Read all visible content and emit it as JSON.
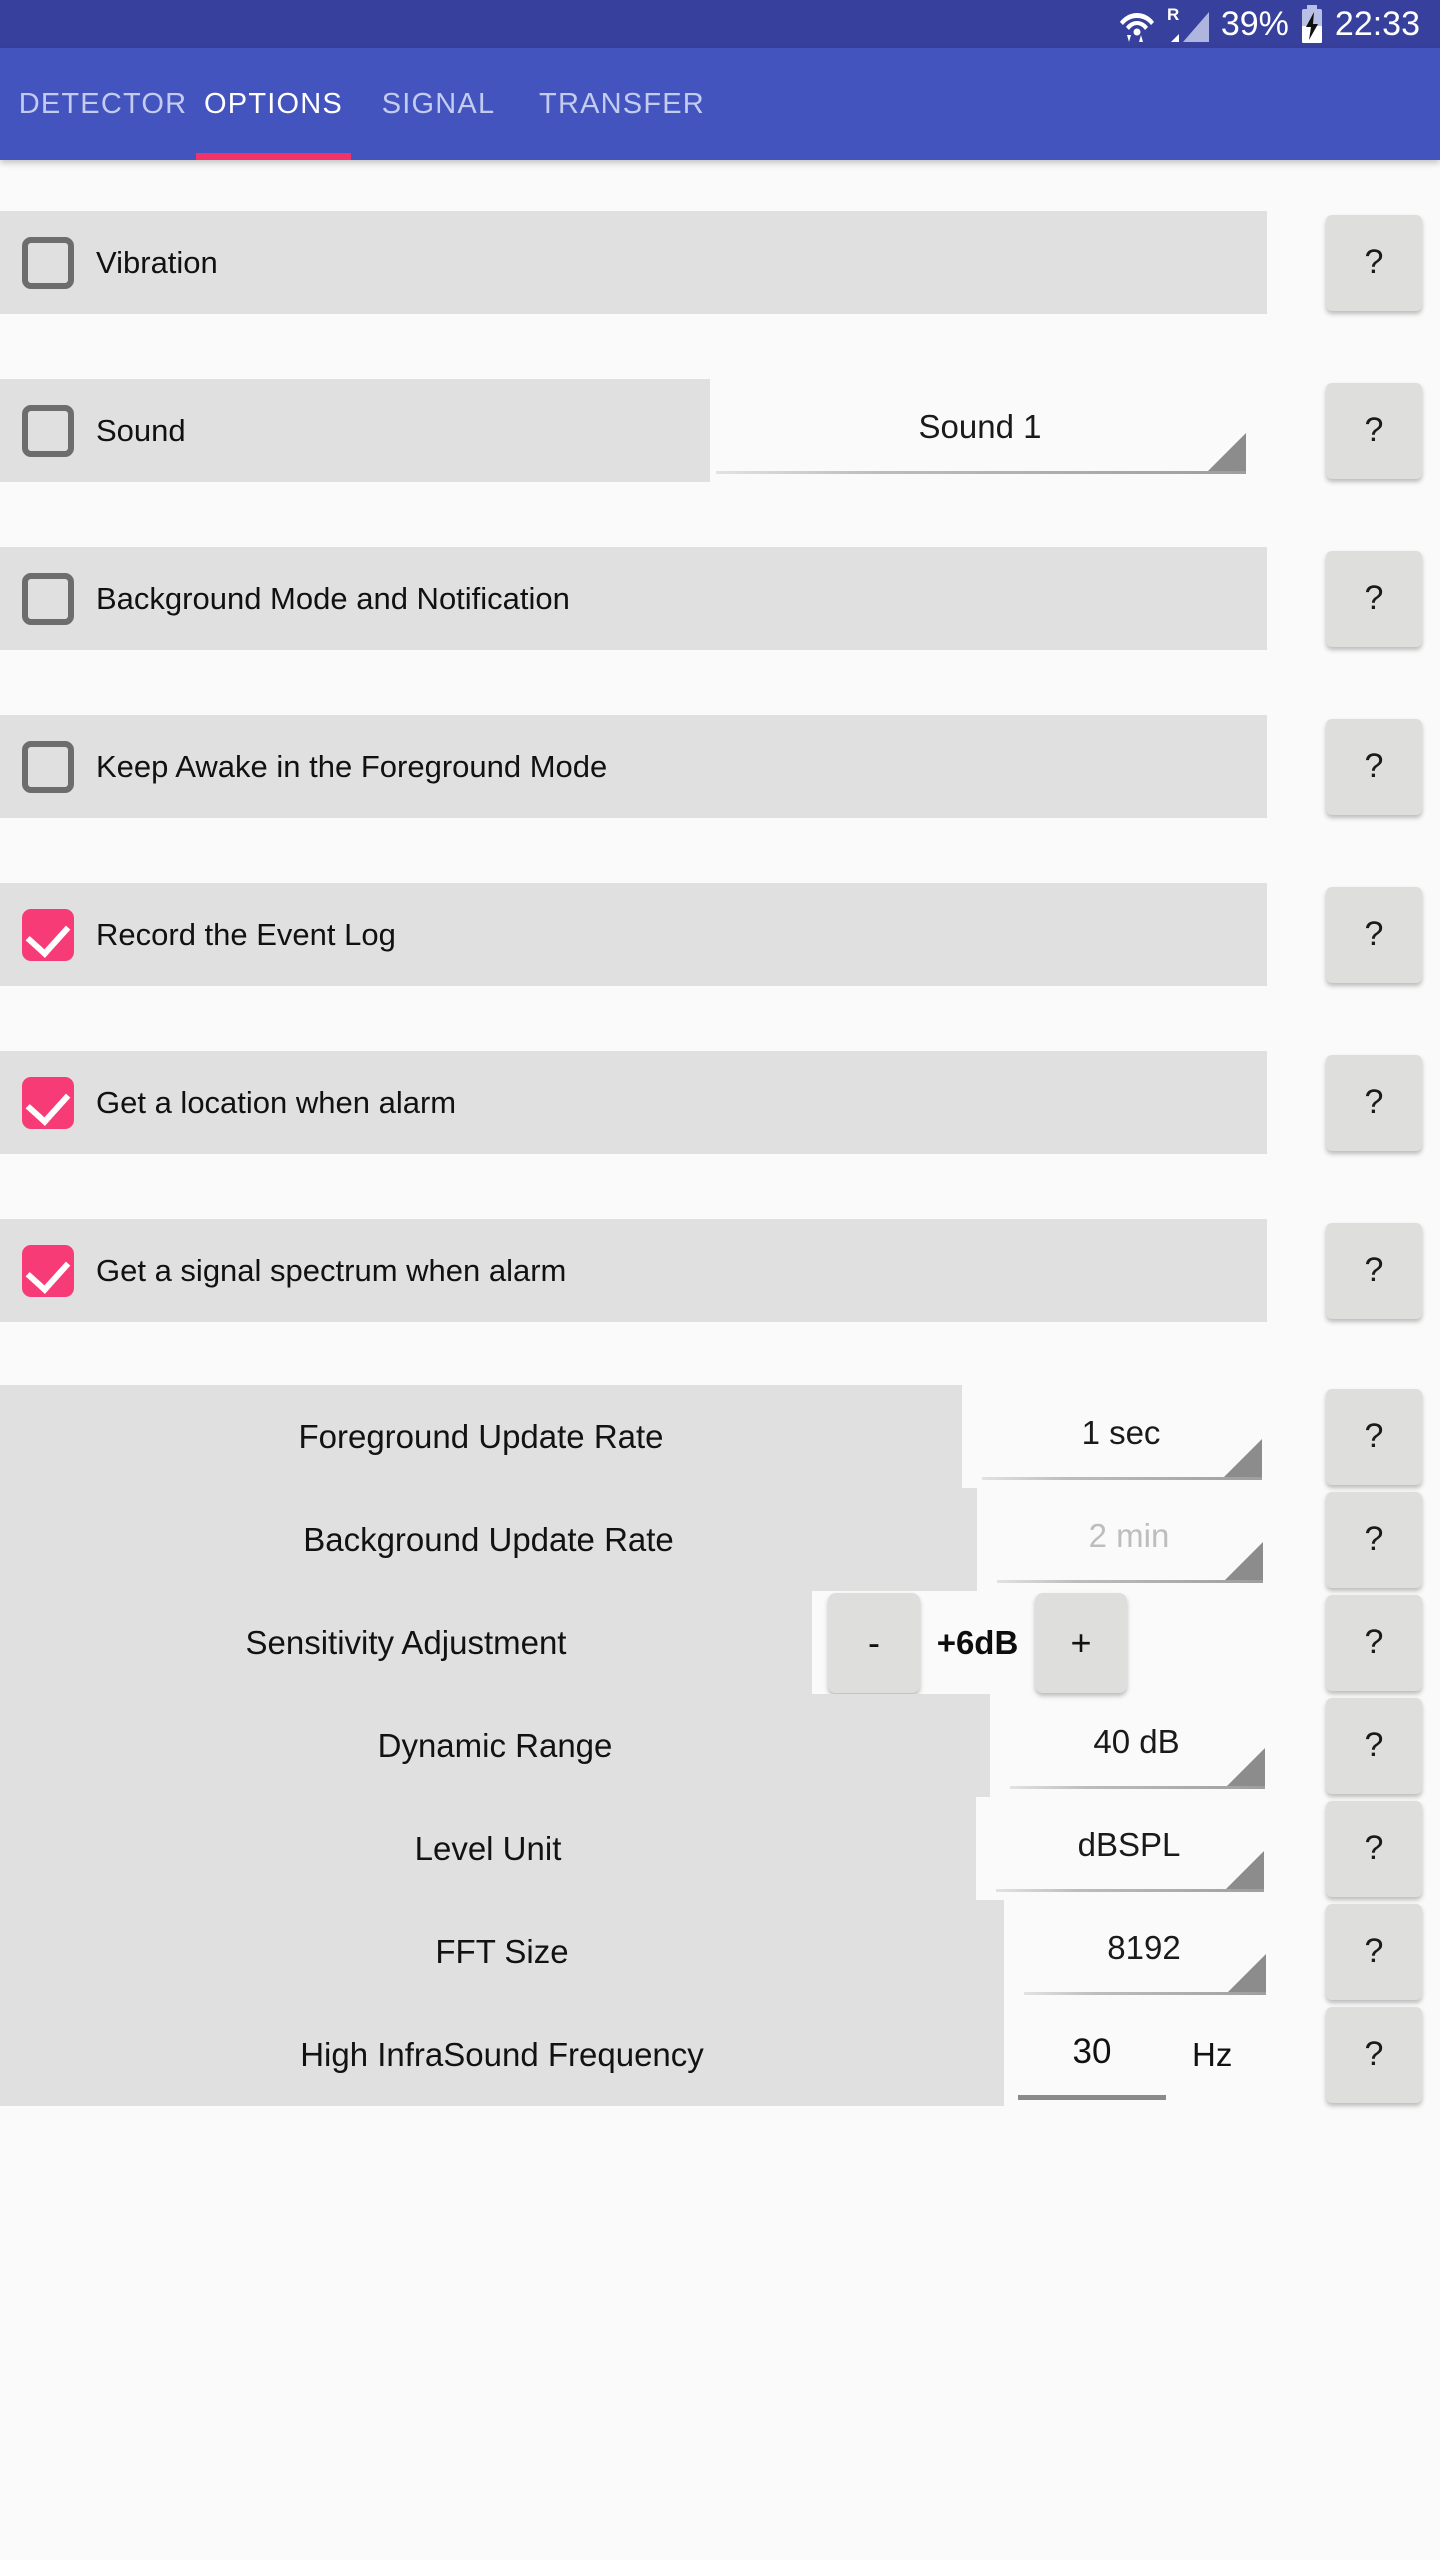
{
  "statusbar": {
    "wifi_icon": "wifi-icon",
    "roaming_label": "R",
    "signal_icon": "cellular-signal-icon",
    "battery_percent": "39%",
    "battery_icon": "battery-charging-icon",
    "time": "22:33"
  },
  "tabs": [
    {
      "label": "DETECTOR",
      "active": false
    },
    {
      "label": "OPTIONS",
      "active": true
    },
    {
      "label": "SIGNAL",
      "active": false
    },
    {
      "label": "TRANSFER",
      "active": false
    }
  ],
  "help_label": "?",
  "colors": {
    "statusbar": "#37409c",
    "tabbar": "#4354bf",
    "tab_indicator": "#f2326b",
    "checkbox_checked": "#f73b77",
    "slab": "#e0e0e0",
    "page_bg": "#fafafa"
  },
  "options": {
    "checkboxes": [
      {
        "label": "Vibration",
        "checked": false
      },
      {
        "label": "Sound",
        "checked": false
      },
      {
        "label": "Background Mode and Notification",
        "checked": false
      },
      {
        "label": "Keep Awake in the Foreground Mode",
        "checked": false
      },
      {
        "label": "Record the Event Log",
        "checked": true
      },
      {
        "label": "Get a location when alarm",
        "checked": true
      },
      {
        "label": "Get a signal spectrum when alarm",
        "checked": true
      }
    ],
    "sound_spinner": {
      "value": "Sound 1",
      "disabled": false
    },
    "settings": [
      {
        "label": "Foreground Update Rate",
        "value": "1 sec",
        "disabled": false
      },
      {
        "label": "Background Update Rate",
        "value": "2 min",
        "disabled": true
      },
      {
        "label": "Dynamic Range",
        "value": "40 dB",
        "disabled": false
      },
      {
        "label": "Level Unit",
        "value": "dBSPL",
        "disabled": false
      },
      {
        "label": "FFT Size",
        "value": "8192",
        "disabled": false
      }
    ],
    "sensitivity": {
      "label": "Sensitivity Adjustment",
      "minus_label": "-",
      "plus_label": "+",
      "value": "+6dB"
    },
    "high_infrasound": {
      "label": "High InfraSound Frequency",
      "value": "30",
      "unit": "Hz"
    }
  }
}
